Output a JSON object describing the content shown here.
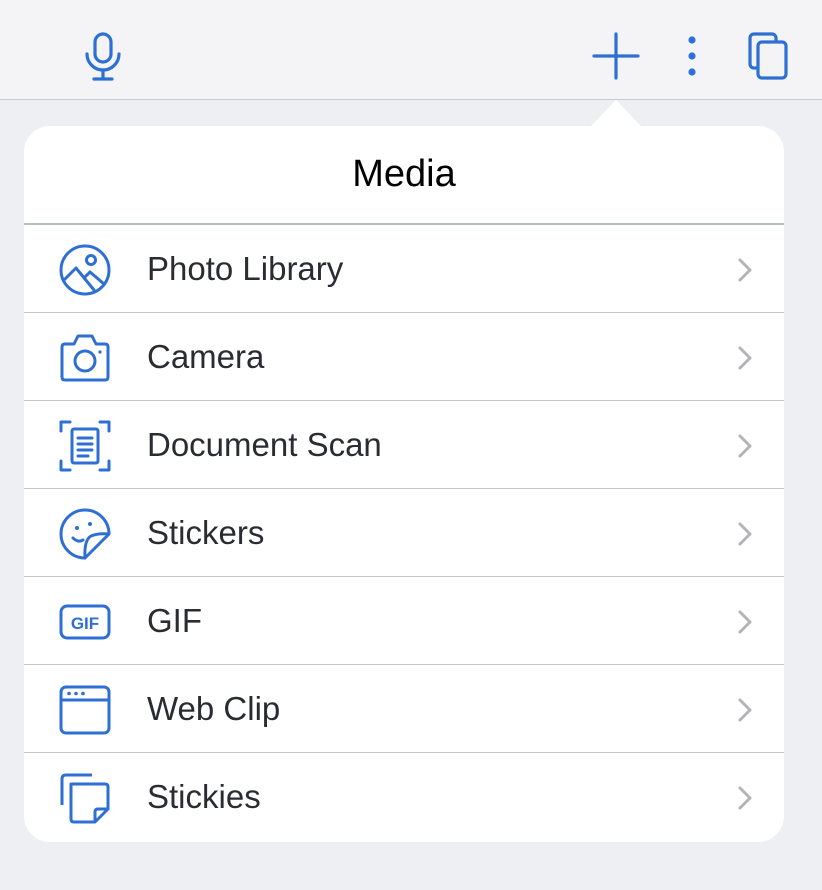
{
  "colors": {
    "accent": "#2e6fd3",
    "chevron": "#b3b3b8",
    "divider": "#c6c6cb",
    "toolbar_bg": "#f4f4f6"
  },
  "toolbar": {
    "icons": [
      "microphone-icon",
      "plus-icon",
      "more-vertical-icon",
      "tabs-icon"
    ]
  },
  "popover": {
    "title": "Media",
    "items": [
      {
        "label": "Photo Library",
        "icon": "photo-library-icon"
      },
      {
        "label": "Camera",
        "icon": "camera-icon"
      },
      {
        "label": "Document Scan",
        "icon": "document-scan-icon"
      },
      {
        "label": "Stickers",
        "icon": "sticker-icon"
      },
      {
        "label": "GIF",
        "icon": "gif-icon"
      },
      {
        "label": "Web Clip",
        "icon": "web-clip-icon"
      },
      {
        "label": "Stickies",
        "icon": "stickies-icon"
      }
    ],
    "gif_badge": "GIF"
  }
}
